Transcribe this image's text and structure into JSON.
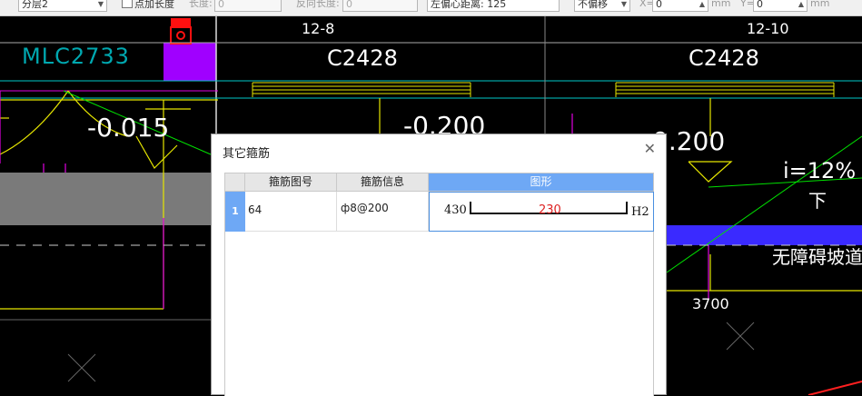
{
  "toolbar": {
    "layer_select": "分层2",
    "point_add_length": "点加长度",
    "length_label": "长度:",
    "length_value": "0",
    "reverse_length_label": "反向长度:",
    "reverse_length_value": "0",
    "left_offset_label": "左偏心距离:",
    "left_offset_value": "125",
    "offset_mode": "不偏移",
    "x_label": "X=",
    "x_value": "0",
    "y_label": "Y=",
    "y_value": "0",
    "unit": "mm"
  },
  "cad": {
    "labels": {
      "axis_left": "12-8",
      "axis_right": "12-10",
      "wall_label": "MLC2733",
      "window_left": "C2428",
      "window_right": "C2428",
      "elev_1": "-0.015",
      "elev_2": "-0.200",
      "elev_3": "0.200",
      "slope": "i=12%",
      "down": "下",
      "ramp": "无障碍坡道",
      "dimension": "3700"
    },
    "colors": {
      "cyan": "#00c8c8",
      "yellow": "#e6e600",
      "magenta": "#e000e0",
      "green": "#00e000",
      "blue_band": "#3a2aff",
      "purple_block": "#a000ff",
      "gray_band": "#7a7a7a"
    }
  },
  "dialog": {
    "title": "其它箍筋",
    "columns": [
      "箍筋图号",
      "箍筋信息",
      "图形"
    ],
    "rows": [
      {
        "index": "1",
        "shape_no": "64",
        "info": "ф8@200",
        "shape": {
          "left": "430",
          "middle": "230",
          "right": "H2"
        }
      }
    ]
  }
}
